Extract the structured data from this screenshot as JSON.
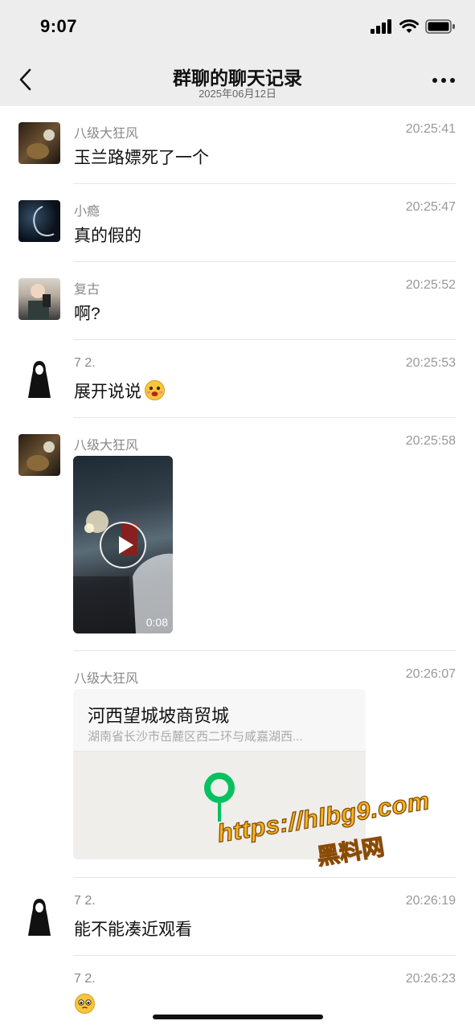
{
  "status_bar": {
    "time": "9:07"
  },
  "header": {
    "title": "群聊的聊天记录",
    "subtitle": "2025年06月12日"
  },
  "messages": [
    {
      "name": "八级大狂风",
      "time": "20:25:41",
      "text": "玉兰路嫖死了一个"
    },
    {
      "name": "小瘾",
      "time": "20:25:47",
      "text": "真的假的"
    },
    {
      "name": "复古",
      "time": "20:25:52",
      "text": "啊?"
    },
    {
      "name": "7 2.",
      "time": "20:25:53",
      "text": "展开说说",
      "emoji": "drooling-face-emoji"
    },
    {
      "name": "八级大狂风",
      "time": "20:25:58",
      "video_duration": "0:08"
    },
    {
      "name": "八级大狂风",
      "time": "20:26:07",
      "location_title": "河西望城坡商贸城",
      "location_address": "湖南省长沙市岳麓区西二环与咸嘉湖西..."
    },
    {
      "name": "7 2.",
      "time": "20:26:19",
      "text": "能不能凑近观看"
    },
    {
      "name": "7 2.",
      "time": "20:26:23",
      "emoji": "pleading-face-emoji"
    }
  ],
  "watermark": {
    "url": "https://hlbg9.com",
    "label": "黑料网"
  },
  "colors": {
    "background": "#ffffff",
    "nav_background": "#ededed",
    "map_pin": "#07c160",
    "watermark": "#f2b623"
  }
}
